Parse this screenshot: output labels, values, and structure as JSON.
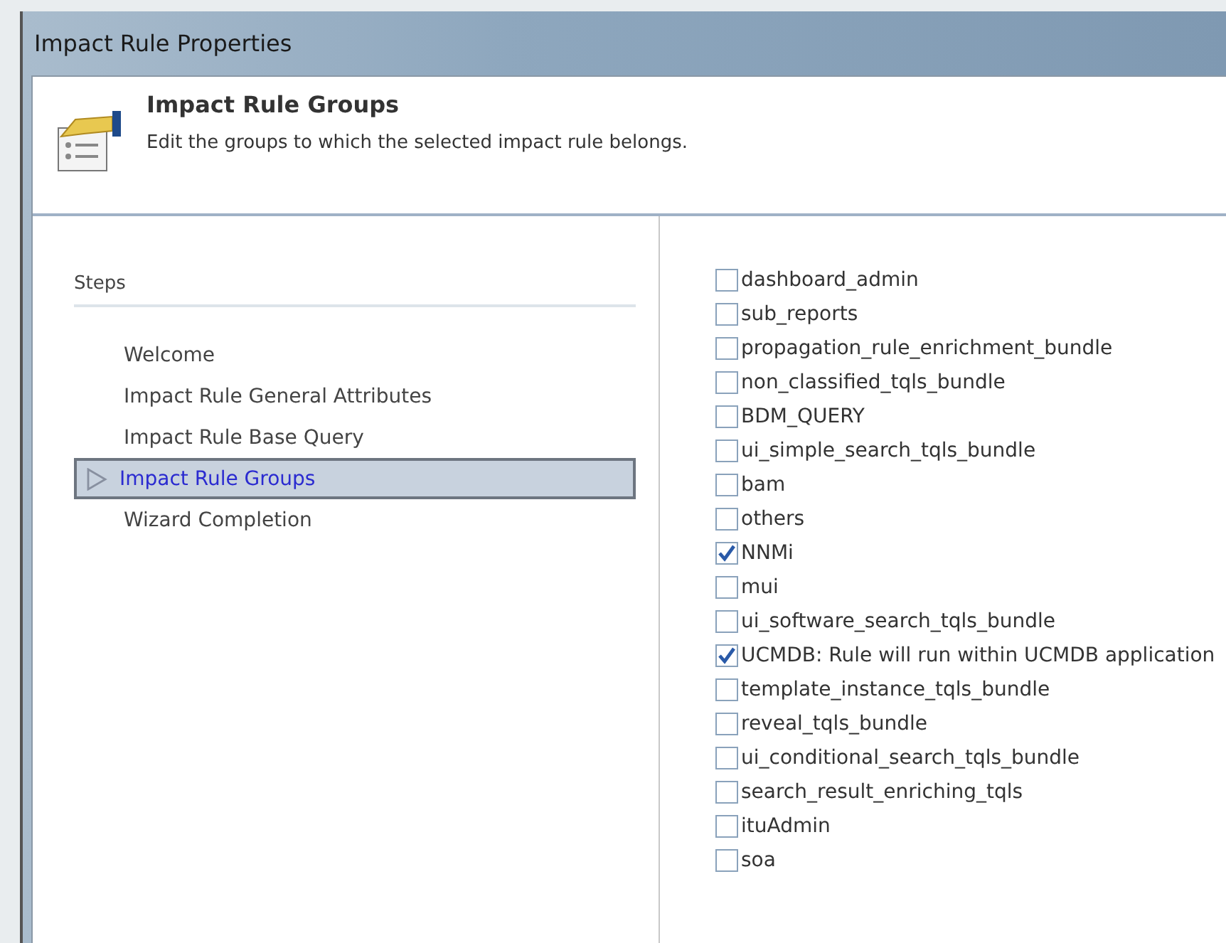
{
  "window": {
    "title": "Impact Rule Properties"
  },
  "header": {
    "title": "Impact Rule Groups",
    "description": "Edit the groups to which the selected impact rule belongs."
  },
  "steps": {
    "title": "Steps",
    "items": [
      {
        "label": "Welcome",
        "selected": false
      },
      {
        "label": "Impact Rule General Attributes",
        "selected": false
      },
      {
        "label": "Impact Rule Base Query",
        "selected": false
      },
      {
        "label": "Impact Rule Groups",
        "selected": true
      },
      {
        "label": "Wizard Completion",
        "selected": false
      }
    ]
  },
  "groups": [
    {
      "label": "dashboard_admin",
      "checked": false
    },
    {
      "label": "sub_reports",
      "checked": false
    },
    {
      "label": "propagation_rule_enrichment_bundle",
      "checked": false
    },
    {
      "label": "non_classified_tqls_bundle",
      "checked": false
    },
    {
      "label": "BDM_QUERY",
      "checked": false
    },
    {
      "label": "ui_simple_search_tqls_bundle",
      "checked": false
    },
    {
      "label": "bam",
      "checked": false
    },
    {
      "label": "others",
      "checked": false
    },
    {
      "label": "NNMi",
      "checked": true
    },
    {
      "label": "mui",
      "checked": false
    },
    {
      "label": "ui_software_search_tqls_bundle",
      "checked": false
    },
    {
      "label": "UCMDB: Rule will run within UCMDB application",
      "checked": true
    },
    {
      "label": "template_instance_tqls_bundle",
      "checked": false
    },
    {
      "label": "reveal_tqls_bundle",
      "checked": false
    },
    {
      "label": "ui_conditional_search_tqls_bundle",
      "checked": false
    },
    {
      "label": "search_result_enriching_tqls",
      "checked": false
    },
    {
      "label": "ituAdmin",
      "checked": false
    },
    {
      "label": "soa",
      "checked": false
    }
  ]
}
